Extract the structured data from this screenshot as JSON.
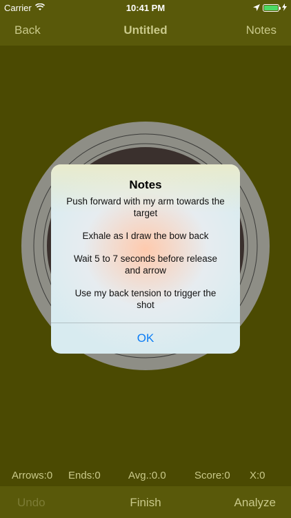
{
  "status_bar": {
    "carrier": "Carrier",
    "time": "10:41 PM",
    "icons": [
      "wifi-icon",
      "location-arrow-icon",
      "battery-icon",
      "charging-bolt-icon"
    ],
    "battery_color": "#4cd964"
  },
  "nav": {
    "back_label": "Back",
    "title": "Untitled",
    "notes_label": "Notes"
  },
  "alert": {
    "title": "Notes",
    "lines": [
      "Push forward with my arm towards the target",
      "Exhale as I draw the bow back",
      "Wait 5 to 7 seconds before release and arrow",
      "Use my back tension to trigger the shot"
    ],
    "ok_label": "OK",
    "ok_color": "#0a7cf5"
  },
  "stats": {
    "arrows": "Arrows:0",
    "ends": "Ends:0",
    "avg": "Avg.:0.0",
    "score": "Score:0",
    "x": "X:0"
  },
  "toolbar": {
    "undo_label": "Undo",
    "finish_label": "Finish",
    "analyze_label": "Analyze"
  },
  "colors": {
    "background": "#4b4a02",
    "bar": "#59590a",
    "accent_text": "#c9c98a",
    "target_outer": "#8e8e86",
    "target_inner": "#3a302d"
  }
}
